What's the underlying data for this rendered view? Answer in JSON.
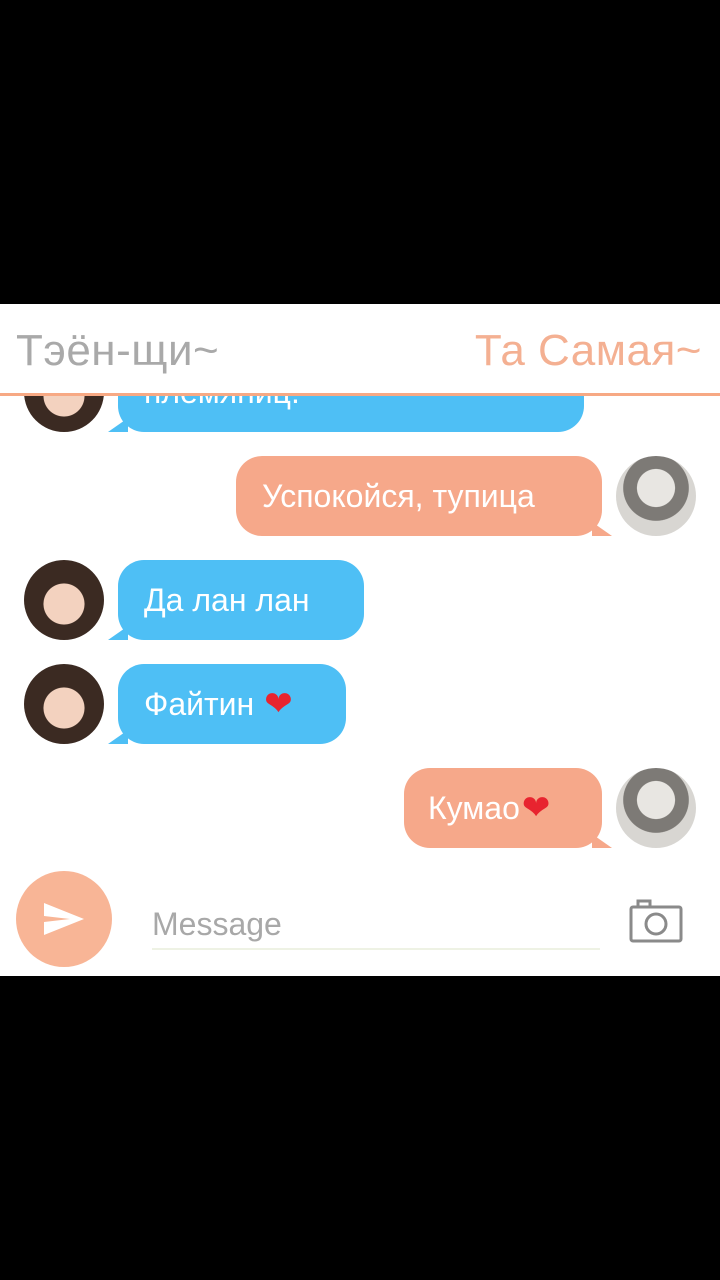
{
  "header": {
    "left_name": "Тэён-щи~",
    "right_name": "Та Самая~"
  },
  "messages": [
    {
      "from": "friend",
      "text": "племяниц."
    },
    {
      "from": "me",
      "text": "Успокойся, тупица"
    },
    {
      "from": "friend",
      "text": "Да лан лан"
    },
    {
      "from": "friend",
      "text": "Файтин"
    },
    {
      "from": "me",
      "text": "Кумао"
    }
  ],
  "composer": {
    "placeholder": "Message"
  },
  "icons": {
    "send": "send-icon",
    "camera": "camera-icon",
    "heart": "heart-emoji"
  },
  "colors": {
    "friend_bubble": "#4ebff5",
    "my_bubble": "#f6a88a",
    "accent": "#f7a984"
  }
}
